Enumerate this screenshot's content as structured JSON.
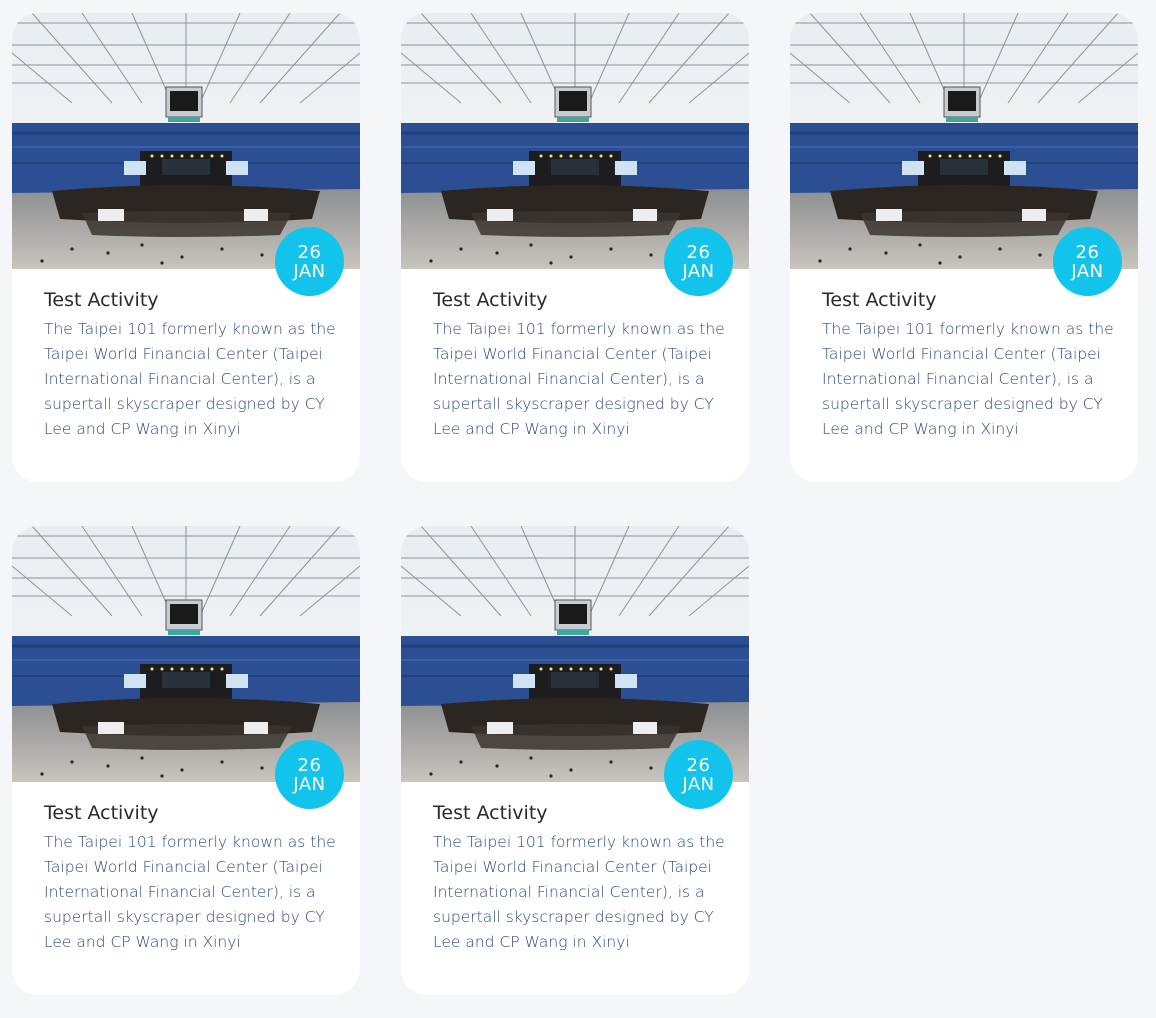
{
  "cards": [
    {
      "title": "Test Activity",
      "description": "The Taipei 101 formerly known as the Taipei World Financial Center (Taipei International Financial Center), is a supertall skyscraper designed by CY Lee and CP Wang in Xinyi",
      "date_day": "26",
      "date_month": "JAN",
      "image": "stadium-concert-photo"
    },
    {
      "title": "Test Activity",
      "description": "The Taipei 101 formerly known as the Taipei World Financial Center (Taipei International Financial Center), is a supertall skyscraper designed by CY Lee and CP Wang in Xinyi",
      "date_day": "26",
      "date_month": "JAN",
      "image": "stadium-concert-photo"
    },
    {
      "title": "Test Activity",
      "description": "The Taipei 101 formerly known as the Taipei World Financial Center (Taipei International Financial Center), is a supertall skyscraper designed by CY Lee and CP Wang in Xinyi",
      "date_day": "26",
      "date_month": "JAN",
      "image": "stadium-concert-photo"
    },
    {
      "title": "Test Activity",
      "description": "The Taipei 101 formerly known as the Taipei World Financial Center (Taipei International Financial Center), is a supertall skyscraper designed by CY Lee and CP Wang in Xinyi",
      "date_day": "26",
      "date_month": "JAN",
      "image": "stadium-concert-photo"
    },
    {
      "title": "Test Activity",
      "description": "The Taipei 101 formerly known as the Taipei World Financial Center (Taipei International Financial Center), is a supertall skyscraper designed by CY Lee and CP Wang in Xinyi",
      "date_day": "26",
      "date_month": "JAN",
      "image": "stadium-concert-photo"
    }
  ],
  "colors": {
    "page_background": "#f4f6f9",
    "card_background": "#ffffff",
    "badge": "#12c4ec",
    "title_text": "#2a2a2a",
    "description_text": "#2f4a7a"
  }
}
